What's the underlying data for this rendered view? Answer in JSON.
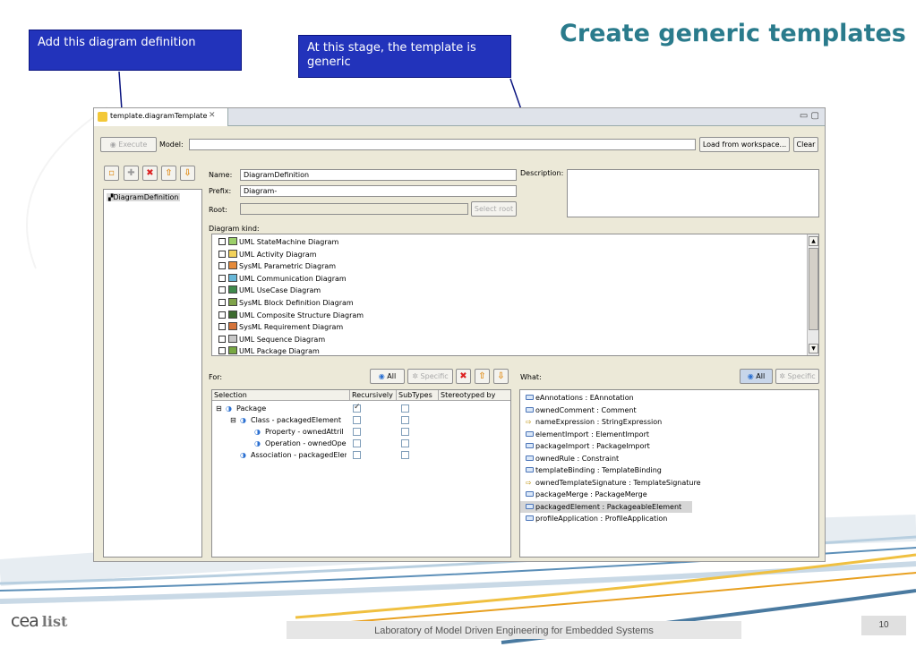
{
  "slide": {
    "title": "Create generic templates",
    "callout_left": "Add this diagram definition",
    "callout_right": "At this stage, the template is generic",
    "footer": "Laboratory of Model Driven Engineering for Embedded Systems",
    "page_number": "10",
    "logo_main": "cea",
    "logo_sub": "list"
  },
  "editor": {
    "tab_label": "template.diagramTemplate",
    "execute_label": "Execute",
    "model_label": "Model:",
    "model_value": "",
    "load_button": "Load from workspace...",
    "clear_button": "Clear"
  },
  "left_panel": {
    "tree_item": "DiagramDefinition"
  },
  "form": {
    "name_label": "Name:",
    "name_value": "DiagramDefinition",
    "prefix_label": "Prefix:",
    "prefix_value": "Diagram-",
    "root_label": "Root:",
    "root_value": "",
    "select_root_button": "Select root",
    "description_label": "Description:",
    "description_value": "",
    "diagram_kind_label": "Diagram kind:"
  },
  "diagram_kinds": [
    {
      "label": "UML StateMachine Diagram",
      "color": "#9ccf6a"
    },
    {
      "label": "UML Activity Diagram",
      "color": "#f3d25a"
    },
    {
      "label": "SysML Parametric Diagram",
      "color": "#e58a3a"
    },
    {
      "label": "UML Communication Diagram",
      "color": "#67b7d8"
    },
    {
      "label": "UML UseCase Diagram",
      "color": "#3f8a4c"
    },
    {
      "label": "SysML Block Definition Diagram",
      "color": "#7fa34a"
    },
    {
      "label": "UML Composite Structure Diagram",
      "color": "#3d6b2f"
    },
    {
      "label": "SysML Requirement Diagram",
      "color": "#d4733a"
    },
    {
      "label": "UML Sequence Diagram",
      "color": "#c8c8c8"
    },
    {
      "label": "UML Package Diagram",
      "color": "#78a842"
    }
  ],
  "for_section": {
    "label": "For:",
    "all_button": "All",
    "specific_button": "Specific",
    "columns": [
      "Selection",
      "Recursively",
      "SubTypes",
      "Stereotyped by"
    ],
    "rows": [
      {
        "toggle": "⊟",
        "label": "Package",
        "recursive": true,
        "subtypes": false
      },
      {
        "toggle": "⊟",
        "label": "Class - packagedElement",
        "recursive": false,
        "subtypes": false
      },
      {
        "toggle": "",
        "label": "Property - ownedAttril",
        "recursive": false,
        "subtypes": false
      },
      {
        "toggle": "",
        "label": "Operation - ownedOpe",
        "recursive": false,
        "subtypes": false
      },
      {
        "toggle": "",
        "label": "Association - packagedEler",
        "recursive": false,
        "subtypes": false
      }
    ]
  },
  "what_section": {
    "label": "What:",
    "all_button": "All",
    "specific_button": "Specific",
    "items": [
      {
        "label": "eAnnotations : EAnnotation",
        "icon": "ref"
      },
      {
        "label": "ownedComment : Comment",
        "icon": "ref"
      },
      {
        "label": "nameExpression : StringExpression",
        "icon": "arrow"
      },
      {
        "label": "elementImport : ElementImport",
        "icon": "ref"
      },
      {
        "label": "packageImport : PackageImport",
        "icon": "ref"
      },
      {
        "label": "ownedRule : Constraint",
        "icon": "ref"
      },
      {
        "label": "templateBinding : TemplateBinding",
        "icon": "ref"
      },
      {
        "label": "ownedTemplateSignature : TemplateSignature",
        "icon": "arrow"
      },
      {
        "label": "packageMerge : PackageMerge",
        "icon": "ref"
      },
      {
        "label": "packagedElement : PackageableElement",
        "icon": "ref",
        "selected": true
      },
      {
        "label": "profileApplication : ProfileApplication",
        "icon": "ref"
      }
    ]
  },
  "colors": {
    "title": "#2a7b8c",
    "callout": "#2233bb"
  }
}
